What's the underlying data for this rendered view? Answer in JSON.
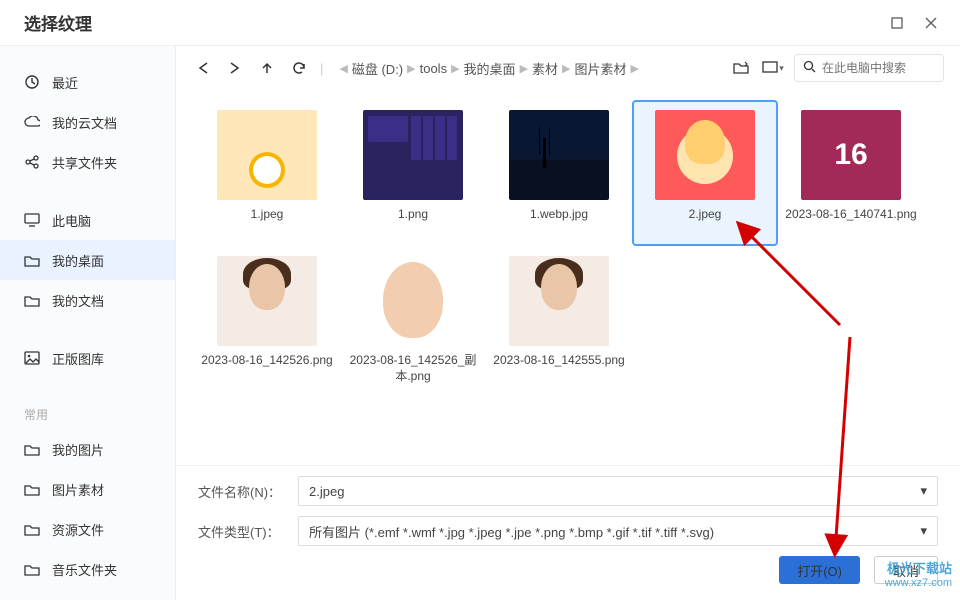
{
  "titlebar": {
    "title": "选择纹理"
  },
  "sidebar": {
    "recent": {
      "icon": "clock-icon",
      "label": "最近"
    },
    "cloud": {
      "icon": "cloud-icon",
      "label": "我的云文档"
    },
    "shared": {
      "icon": "share-icon",
      "label": "共享文件夹"
    },
    "thispc": {
      "icon": "monitor-icon",
      "label": "此电脑"
    },
    "desktop": {
      "icon": "folder-icon",
      "label": "我的桌面"
    },
    "mydocs": {
      "icon": "folder-icon",
      "label": "我的文档"
    },
    "gallery": {
      "icon": "image-icon",
      "label": "正版图库"
    },
    "section": "常用",
    "pics": {
      "icon": "folder-icon",
      "label": "我的图片"
    },
    "picmat": {
      "icon": "folder-icon",
      "label": "图片素材"
    },
    "resfiles": {
      "icon": "folder-icon",
      "label": "资源文件"
    },
    "music": {
      "icon": "folder-icon",
      "label": "音乐文件夹"
    }
  },
  "breadcrumbs": [
    "磁盘 (D:)",
    "tools",
    "我的桌面",
    "素材",
    "图片素材"
  ],
  "search": {
    "placeholder": "在此电脑中搜索"
  },
  "files": {
    "items": [
      {
        "name": "1.jpeg",
        "selected": false,
        "thumb": "t1"
      },
      {
        "name": "1.png",
        "selected": false,
        "thumb": "t2"
      },
      {
        "name": "1.webp.jpg",
        "selected": false,
        "thumb": "t3"
      },
      {
        "name": "2.jpeg",
        "selected": true,
        "thumb": "t4"
      },
      {
        "name": "2023-08-16_140741.png",
        "selected": false,
        "thumb": "t5",
        "badge": "16"
      },
      {
        "name": "2023-08-16_142526.png",
        "selected": false,
        "thumb": "t6"
      },
      {
        "name": "2023-08-16_142526_副本.png",
        "selected": false,
        "thumb": "t7"
      },
      {
        "name": "2023-08-16_142555.png",
        "selected": false,
        "thumb": "t8"
      }
    ]
  },
  "bottom": {
    "name_label": "文件名称(N)：",
    "name_value": "2.jpeg",
    "type_label": "文件类型(T)：",
    "type_value": "所有图片 (*.emf *.wmf *.jpg *.jpeg *.jpe *.png *.bmp *.gif *.tif *.tiff *.svg)",
    "open": "打开(O)",
    "cancel": "取消"
  },
  "watermark": {
    "line1": "极光下载站",
    "line2": "www.xz7.com"
  }
}
